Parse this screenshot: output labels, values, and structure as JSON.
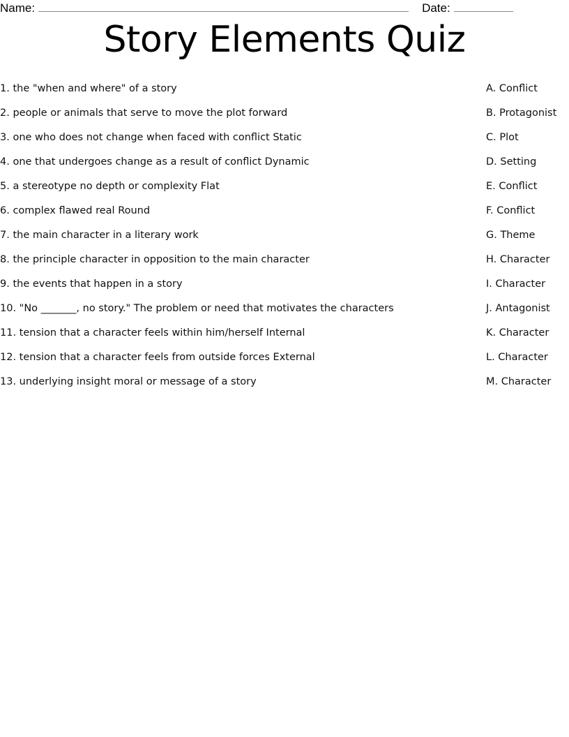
{
  "header": {
    "name_label": "Name:",
    "date_label": "Date:"
  },
  "title": "Story Elements Quiz",
  "questions": [
    {
      "number": "1.",
      "text": "the \"when and where\" of a story"
    },
    {
      "number": "2.",
      "text": "people or animals that serve to move the plot forward"
    },
    {
      "number": "3.",
      "text": "one who does not change when faced with conflict Static"
    },
    {
      "number": "4.",
      "text": "one that undergoes change as a result of conflict Dynamic"
    },
    {
      "number": "5.",
      "text": "a stereotype no depth or complexity Flat"
    },
    {
      "number": "6.",
      "text": "complex flawed real Round"
    },
    {
      "number": "7.",
      "text": "the main character in a literary work"
    },
    {
      "number": "8.",
      "text": "the principle character in opposition to the main character"
    },
    {
      "number": "9.",
      "text": "the events that happen in a story"
    },
    {
      "number": "10.",
      "text": "\"No _______, no story.\" The problem or need that motivates the characters"
    },
    {
      "number": "11.",
      "text": "tension that a character feels within him/herself Internal"
    },
    {
      "number": "12.",
      "text": "tension that a character feels from outside forces External"
    },
    {
      "number": "13.",
      "text": "underlying insight moral or message of a story"
    }
  ],
  "answers": [
    {
      "letter": "A.",
      "text": "Conflict"
    },
    {
      "letter": "B.",
      "text": "Protagonist"
    },
    {
      "letter": "C.",
      "text": "Plot"
    },
    {
      "letter": "D.",
      "text": "Setting"
    },
    {
      "letter": "E.",
      "text": "Conflict"
    },
    {
      "letter": "F.",
      "text": "Conflict"
    },
    {
      "letter": "G.",
      "text": "Theme"
    },
    {
      "letter": "H.",
      "text": "Character"
    },
    {
      "letter": "I.",
      "text": "Character"
    },
    {
      "letter": "J.",
      "text": "Antagonist"
    },
    {
      "letter": "K.",
      "text": "Character"
    },
    {
      "letter": "L.",
      "text": "Character"
    },
    {
      "letter": "M.",
      "text": "Character"
    }
  ],
  "rows": [
    {
      "question": "1. the \"when and where\" of a story",
      "answer": "A. Conflict"
    },
    {
      "question": "2. people or animals that serve to move the plot forward",
      "answer": "B. Protagonist"
    },
    {
      "question": "3. one who does not change when faced with conflict Static",
      "answer": "C. Plot"
    },
    {
      "question": "4. one that undergoes change as a result of conflict Dynamic",
      "answer": "D. Setting"
    },
    {
      "question": "5. a stereotype no depth or complexity Flat",
      "answer": "E. Conflict"
    },
    {
      "question": "6. complex flawed real Round",
      "answer": "F. Conflict"
    },
    {
      "question": "7. the main character in a literary work",
      "answer": "G. Theme"
    },
    {
      "question": "8. the principle character in opposition to the main character",
      "answer": "H. Character"
    },
    {
      "question": "9. the events that happen in a story",
      "answer": "I. Character"
    },
    {
      "question": "10. \"No _______, no story.\" The problem or need that motivates the characters",
      "answer": "J. Antagonist"
    },
    {
      "question": "11. tension that a character feels within him/herself Internal",
      "answer": "K. Character"
    },
    {
      "question": "12. tension that a character feels from outside forces External",
      "answer": "L. Character"
    },
    {
      "question": "13. underlying insight moral or message of a story",
      "answer": "M. Character"
    }
  ]
}
